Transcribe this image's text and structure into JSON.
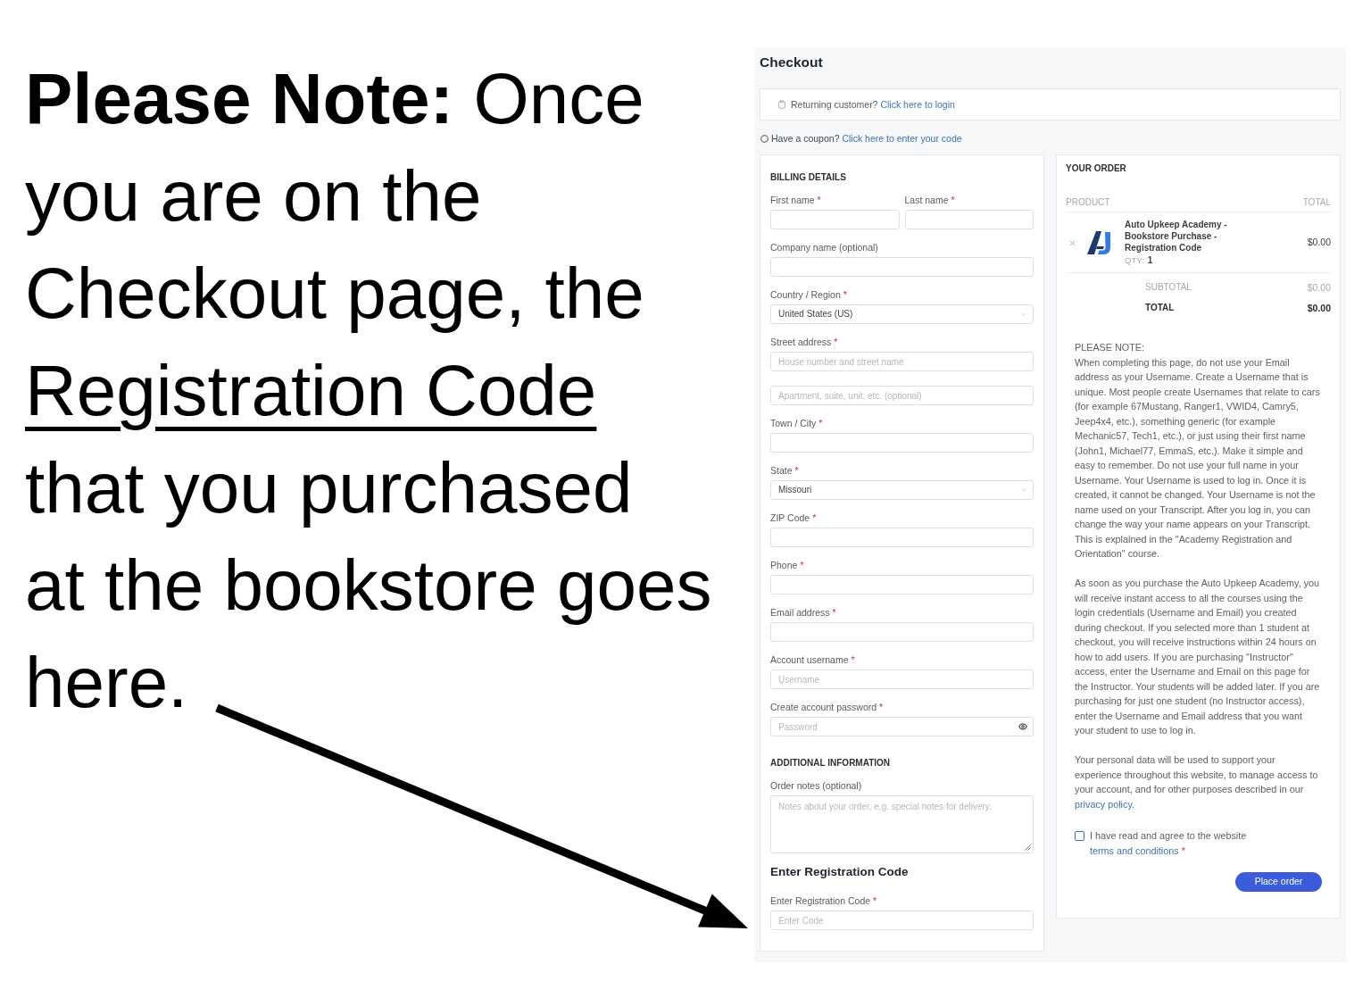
{
  "note": {
    "lines": [
      {
        "text": "**Please Note:** Once",
        "underlined": false
      },
      {
        "text": "you are on the",
        "underlined": false
      },
      {
        "text": "Checkout page, the",
        "underlined": false
      },
      {
        "text": "Registration Code",
        "underlined": true
      },
      {
        "text": "that you purchased",
        "underlined": false
      },
      {
        "text": "at the bookstore goes",
        "underlined": false
      },
      {
        "text": "here.",
        "underlined": false
      }
    ]
  },
  "checkout": {
    "title": "Checkout",
    "returning_customer": {
      "text": "Returning customer?",
      "link": "Click here to login"
    },
    "coupon": {
      "text": "Have a coupon?",
      "link": "Click here to enter your code"
    },
    "billing_details": {
      "title": "BILLING DETAILS",
      "rows": [
        {
          "fields": [
            {
              "kind": "text",
              "label": "First name",
              "required_mark": "*"
            },
            {
              "kind": "text",
              "label": "Last name",
              "required_mark": "*"
            }
          ]
        },
        {
          "fields": [
            {
              "kind": "text",
              "label": "Company name (optional)"
            }
          ]
        },
        {
          "fields": [
            {
              "kind": "select",
              "label": "Country / Region",
              "required_mark": "*",
              "value": "United States (US)"
            }
          ]
        },
        {
          "fields": [
            {
              "kind": "text",
              "label": "Street address",
              "required_mark": "*",
              "placeholder": "House number and street name"
            }
          ]
        },
        {
          "fields": [
            {
              "kind": "text",
              "placeholder": "Apartment, suite, unit, etc. (optional)"
            }
          ]
        },
        {
          "fields": [
            {
              "kind": "text",
              "label": "Town / City",
              "required_mark": "*"
            }
          ]
        },
        {
          "fields": [
            {
              "kind": "select",
              "label": "State",
              "required_mark": "*",
              "value": "Missouri"
            }
          ]
        },
        {
          "fields": [
            {
              "kind": "text",
              "label": "ZIP Code",
              "required_mark": "*"
            }
          ]
        },
        {
          "fields": [
            {
              "kind": "text",
              "label": "Phone",
              "required_mark": "*"
            }
          ]
        },
        {
          "fields": [
            {
              "kind": "text",
              "label": "Email address",
              "required_mark": "*"
            }
          ]
        },
        {
          "fields": [
            {
              "kind": "text",
              "label": "Account username",
              "required_mark": "*",
              "placeholder": "Username"
            }
          ]
        },
        {
          "fields": [
            {
              "kind": "password",
              "label": "Create account password",
              "required_mark": "*",
              "placeholder": "Password"
            }
          ]
        }
      ]
    },
    "additional_information": {
      "title": "ADDITIONAL INFORMATION",
      "fields": [
        {
          "kind": "textarea",
          "label": "Order notes (optional)",
          "placeholder": "Notes about your order, e.g. special notes for delivery."
        }
      ]
    },
    "registration": {
      "title": "Enter Registration Code",
      "fields": [
        {
          "kind": "text",
          "label": "Enter Registration Code",
          "required_mark": "*",
          "placeholder": "Enter Code"
        }
      ]
    },
    "order": {
      "title": "YOUR ORDER",
      "columns": [
        "PRODUCT",
        "TOTAL"
      ],
      "items": [
        {
          "name": "Auto Upkeep Academy - Bookstore Purchase - Registration Code",
          "qty_label": "QTY:",
          "qty": "1",
          "total": "$0.00"
        }
      ],
      "totals": [
        {
          "kind": "subtotal",
          "label": "SUBTOTAL",
          "value": "$0.00"
        },
        {
          "kind": "total",
          "label": "TOTAL",
          "value": "$0.00"
        }
      ],
      "notice": {
        "title": "PLEASE NOTE:",
        "paragraphs": [
          "When completing this page, do not use your Email address as your Username. Create a Username that is unique. Most people create Usernames that relate to cars (for example 67Mustang, Ranger1, VWID4, Camry5, Jeep4x4, etc.), something generic (for example Mechanic57, Tech1, etc.), or just using their first name (John1, Michael77, EmmaS, etc.). Make it simple and easy to remember. Do not use your full name in your Username. Your Username is used to log in. Once it is created, it cannot be changed. Your Username is not the name used on your Transcript. After you log in, you can change the way your name appears on your Transcript. This is explained in the \"Academy Registration and Orientation\" course.",
          "As soon as you purchase the Auto Upkeep Academy, you will receive instant access to all the courses using the login credentials (Username and Email) you created during checkout. If you selected more than 1 student at checkout, you will receive instructions within 24 hours on how to add users. If you are purchasing \"Instructor\" access, enter the Username and Email on this page for the Instructor. Your students will be added later. If you are purchasing for just one student (no Instructor access), enter the Username and Email address that you want your student to use to log in."
        ]
      },
      "privacy": {
        "text": "Your personal data will be used to support your experience throughout this website, to manage access to your account, and for other purposes described in our",
        "link": "privacy policy",
        "after": "."
      },
      "terms": {
        "checked": false,
        "text": "I have read and agree to the website",
        "link": "terms and conditions",
        "required_mark": "*"
      },
      "place_order_button": "Place order"
    }
  }
}
